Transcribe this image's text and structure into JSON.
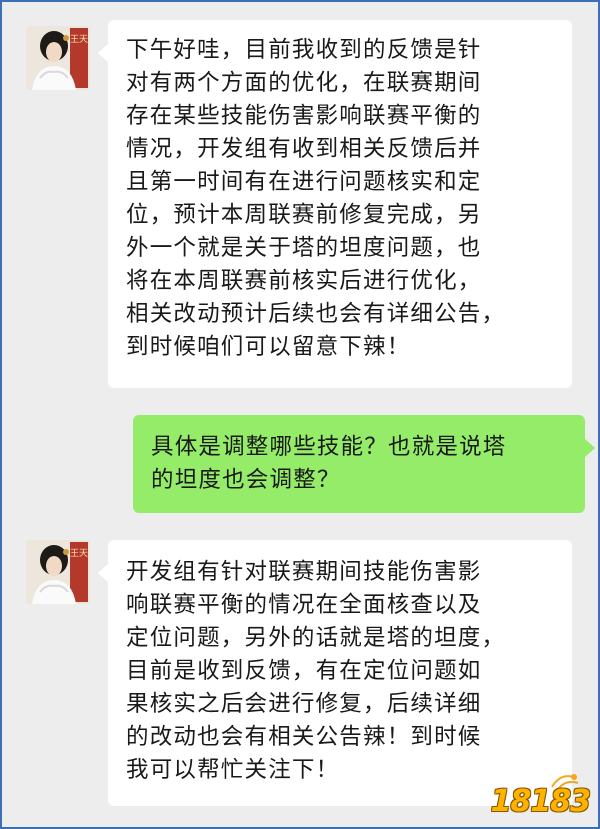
{
  "messages": [
    {
      "sender": "other",
      "lines": [
        "下午好哇，目前我收到的反馈是针",
        "对有两个方面的优化，在联赛期间",
        "存在某些技能伤害影响联赛平衡的",
        "情况，开发组有收到相关反馈后并",
        "且第一时间有在进行问题核实和定",
        "位，预计本周联赛前修复完成，另",
        "外一个就是关于塔的坦度问题，也",
        "将在本周联赛前核实后进行优化，",
        "相关改动预计后续也会有详细公告，",
        "到时候咱们可以留意下辣！"
      ]
    },
    {
      "sender": "self",
      "lines": [
        "具体是调整哪些技能？也就是说塔",
        "的坦度也会调整？"
      ]
    },
    {
      "sender": "other",
      "lines": [
        "开发组有针对联赛期间技能伤害影",
        "响联赛平衡的情况在全面核查以及",
        "定位问题，另外的话就是塔的坦度，",
        "目前是收到反馈，有在定位问题如",
        "果核实之后会进行修复，后续详细",
        "的改动也会有相关公告辣！到时候",
        "我可以帮忙关注下！"
      ]
    }
  ],
  "avatar_badge": "王天",
  "watermark": "18183",
  "colors": {
    "chat_background": "#ededed",
    "incoming_bubble": "#ffffff",
    "outgoing_bubble": "#95ec69",
    "frame_border": "#3b6fb6",
    "text": "#191919",
    "watermark": "#ffb300"
  },
  "icons": {
    "avatar": "character-portrait-avatar",
    "watermark": "18183-logo"
  }
}
